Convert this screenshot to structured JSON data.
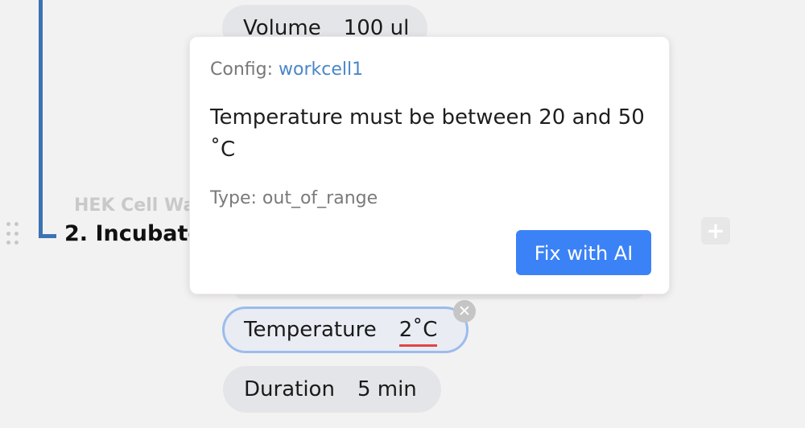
{
  "step": {
    "number_title": "2. Incubate",
    "subtitle": "HEK Cell Was"
  },
  "params": {
    "volume": {
      "label": "Volume",
      "value": "100 ul"
    },
    "temperature": {
      "label": "Temperature",
      "value": "2˚C"
    },
    "duration": {
      "label": "Duration",
      "value": "5 min"
    }
  },
  "popover": {
    "config_label": "Config:",
    "config_value": "workcell1",
    "message": "Temperature must be between 20 and 50 ˚C",
    "type_label": "Type: out_of_range",
    "fix_button": "Fix with AI"
  },
  "icons": {
    "add": "+",
    "clear": "✕"
  },
  "colors": {
    "timeline": "#3b73b3",
    "accent": "#3b82f6",
    "error_underline": "#e04545",
    "link": "#4a86c8"
  }
}
